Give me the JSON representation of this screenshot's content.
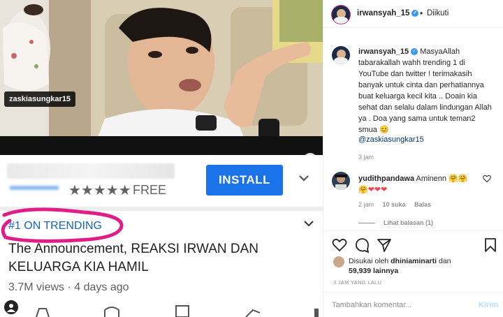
{
  "media": {
    "tag_label": "zaskiasungkar15",
    "ad": {
      "stars": "★★★★★",
      "free_label": "FREE",
      "install_label": "INSTALL"
    },
    "trending_label": "#1 ON TRENDING",
    "video_title": "The Announcement, REAKSI IRWAN DAN KELUARGA KIA HAMIL",
    "video_meta": "3.7M views · 4 days ago"
  },
  "post": {
    "header": {
      "username": "irwansyah_15",
      "verified_mark": "✓",
      "dot": "•",
      "follow_status": "Diikuti"
    },
    "caption": {
      "username": "irwansyah_15",
      "text": "MasyaAllah tabarakallah wahh trending 1 di YouTube dan twitter ! terimakasih banyak untuk cinta dan perhatiannya buat keluarga kecil kita .. Doain kia sehat dan selalu dalam lindungan Allah ya . Doa yang sama untuk teman2 smua 😊",
      "mention": "@zaskiasungkar15",
      "time": "3 jam"
    },
    "comment": {
      "username": "yudithpandawa",
      "text": "Aminenn",
      "emojis": "🤗🤗",
      "emoji2": "🤗",
      "hearts": "❤❤❤",
      "time": "2 jam",
      "likes": "10 suka",
      "reply": "Balas",
      "view_replies": "Lihat balasan (1)"
    },
    "likes": {
      "prefix": "Disukai oleh",
      "user": "dhiniaminarti",
      "joiner": "dan",
      "count": "59,939 lainnya"
    },
    "timestamp": "3 JAM YANG LALU",
    "comment_box": {
      "placeholder": "Tambahkan komentar...",
      "post_label": "Kirim"
    }
  }
}
